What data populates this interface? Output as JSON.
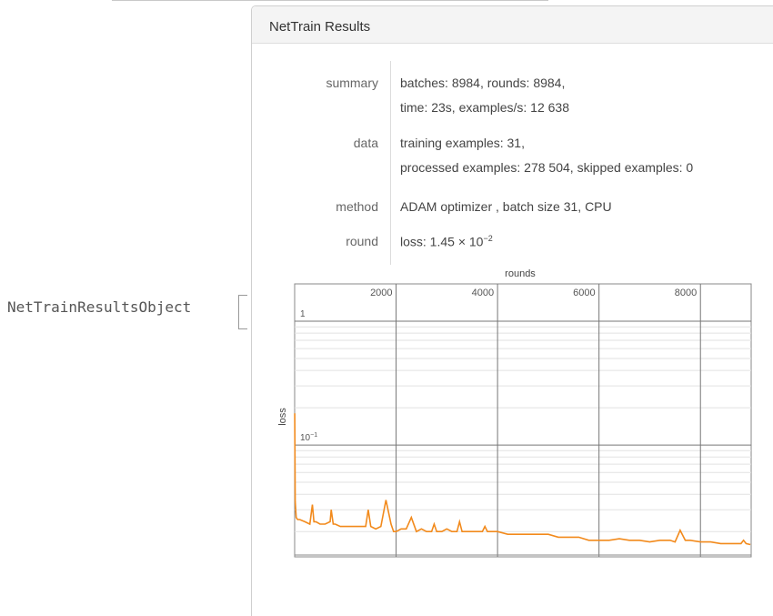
{
  "input_label": "NetTrainResultsObject",
  "panel": {
    "title": "NetTrain Results",
    "rows": [
      {
        "key": "summary",
        "lines": [
          "batches: 8984, rounds: 8984,",
          "time: 23s, examples/s: 12 638"
        ]
      },
      {
        "key": "data",
        "lines": [
          "training examples: 31,",
          "processed examples: 278 504, skipped examples: 0"
        ]
      },
      {
        "key": "method",
        "lines": [
          "ADAM optimizer , batch size 31, CPU"
        ]
      },
      {
        "key": "round",
        "loss_prefix": "loss: 1.45 × 10",
        "loss_exp": "−2"
      }
    ]
  },
  "chart_data": {
    "type": "line",
    "xlabel": "rounds",
    "ylabel": "loss",
    "xscale": "linear",
    "yscale": "log",
    "xlim": [
      0,
      9000
    ],
    "x_ticks": [
      "2000",
      "4000",
      "6000",
      "8000"
    ],
    "x_tick_values": [
      2000,
      4000,
      6000,
      8000
    ],
    "y_ticks": [
      {
        "base": "1",
        "exp": ""
      },
      {
        "base": "10",
        "exp": "−1"
      }
    ],
    "y_tick_values": [
      1,
      0.1
    ],
    "ylim": [
      0.0125,
      2
    ],
    "line_color": "#f28a1c",
    "series": [
      {
        "x": [
          1,
          10,
          30,
          60,
          100,
          200,
          300,
          350,
          380,
          420,
          500,
          600,
          700,
          720,
          760,
          800,
          900,
          1000,
          1200,
          1400,
          1450,
          1500,
          1600,
          1700,
          1800,
          1900,
          1950,
          2000,
          2100,
          2200,
          2300,
          2400,
          2500,
          2600,
          2700,
          2750,
          2800,
          2900,
          3000,
          3100,
          3200,
          3250,
          3300,
          3400,
          3500,
          3600,
          3700,
          3750,
          3800,
          3900,
          4000,
          4200,
          4400,
          4600,
          4800,
          5000,
          5200,
          5400,
          5600,
          5800,
          6000,
          6200,
          6400,
          6600,
          6800,
          7000,
          7200,
          7400,
          7500,
          7600,
          7700,
          7800,
          8000,
          8200,
          8400,
          8600,
          8800,
          8850,
          8900,
          8984
        ],
        "y": [
          0.18,
          0.035,
          0.026,
          0.025,
          0.025,
          0.024,
          0.023,
          0.033,
          0.024,
          0.024,
          0.023,
          0.023,
          0.024,
          0.03,
          0.023,
          0.023,
          0.022,
          0.022,
          0.022,
          0.022,
          0.03,
          0.022,
          0.021,
          0.022,
          0.036,
          0.023,
          0.02,
          0.02,
          0.021,
          0.021,
          0.026,
          0.02,
          0.021,
          0.02,
          0.02,
          0.023,
          0.02,
          0.02,
          0.021,
          0.02,
          0.02,
          0.024,
          0.02,
          0.02,
          0.02,
          0.02,
          0.02,
          0.022,
          0.02,
          0.02,
          0.02,
          0.019,
          0.019,
          0.019,
          0.019,
          0.019,
          0.018,
          0.018,
          0.018,
          0.017,
          0.017,
          0.017,
          0.0175,
          0.017,
          0.017,
          0.0165,
          0.017,
          0.017,
          0.0165,
          0.0205,
          0.017,
          0.017,
          0.0165,
          0.0165,
          0.016,
          0.016,
          0.016,
          0.017,
          0.016,
          0.0157
        ]
      }
    ]
  }
}
